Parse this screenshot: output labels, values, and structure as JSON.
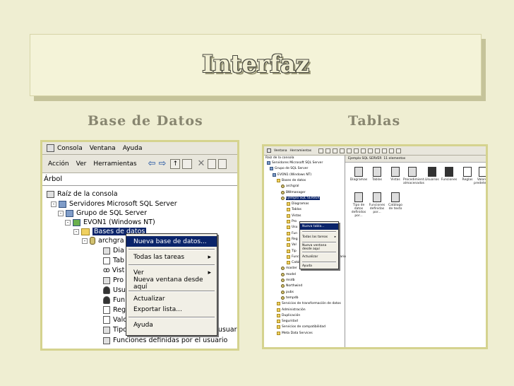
{
  "slide": {
    "title": "Interfaz",
    "left_caption": "Base de Datos",
    "right_caption": "Tablas"
  },
  "left": {
    "menu": [
      "Consola",
      "Ventana",
      "Ayuda"
    ],
    "toolbar_menu": [
      "Acción",
      "Ver",
      "Herramientas"
    ],
    "tree_header": "Árbol",
    "tree": [
      "Raíz de la consola",
      "Servidores Microsoft SQL Server",
      "Grupo de SQL Server",
      "EVON1 (Windows NT)",
      "Bases de datos",
      "archgra",
      "Dia",
      "Tab",
      "Vist",
      "Pro",
      "Usu",
      "Fun",
      "Reg",
      "Valo",
      "Tipos de datos definidos por el usuario",
      "Funciones definidas por el usuario"
    ],
    "context_menu": [
      "Nueva base de datos...",
      "Todas las tareas",
      "Ver",
      "Nueva ventana desde aquí",
      "Actualizar",
      "Exportar lista...",
      "Ayuda"
    ]
  },
  "right": {
    "menu": [
      "Ventana",
      "Herramientas"
    ],
    "tree_header": "Raíz de la consola",
    "header": "Ejemplo SQL SERVER",
    "count": "11 elementos",
    "tree": [
      "Servidores Microsoft SQL Server",
      "Grupo de SQL Server",
      "EVON1 (Windows NT)",
      "Bases de datos",
      "archgral",
      "BWmanager",
      "Ejemplo SQL SERVER",
      "Diagramas",
      "Tablas",
      "Vistas",
      "Pro",
      "Usu",
      "Fun",
      "Reg",
      "Val",
      "Tip",
      "Funciones definidas por el usuario",
      "Catálogo de texto",
      "master",
      "model",
      "msdb",
      "Northwind",
      "pubs",
      "tempdb",
      "Servicios de transformación de datos",
      "Administración",
      "Duplicación",
      "Seguridad",
      "Servicios de compatibilidad",
      "Meta Data Services"
    ],
    "context_menu": [
      "Nueva tabla...",
      "Todas las tareas",
      "Nueva ventana desde aquí",
      "Actualizar",
      "Ayuda"
    ],
    "icons": [
      "Diagramas",
      "Tablas",
      "Vistas",
      "Procedimient... almacenados",
      "Usuarios",
      "Funciones",
      "Reglas",
      "Valores predetermin...",
      "Tipo de datos definidos por...",
      "Funciones definidas por...",
      "Catálogo de texto"
    ]
  },
  "colors": {
    "background": "#efeed2",
    "frame": "#d5d38f",
    "selection": "#0a246a"
  }
}
